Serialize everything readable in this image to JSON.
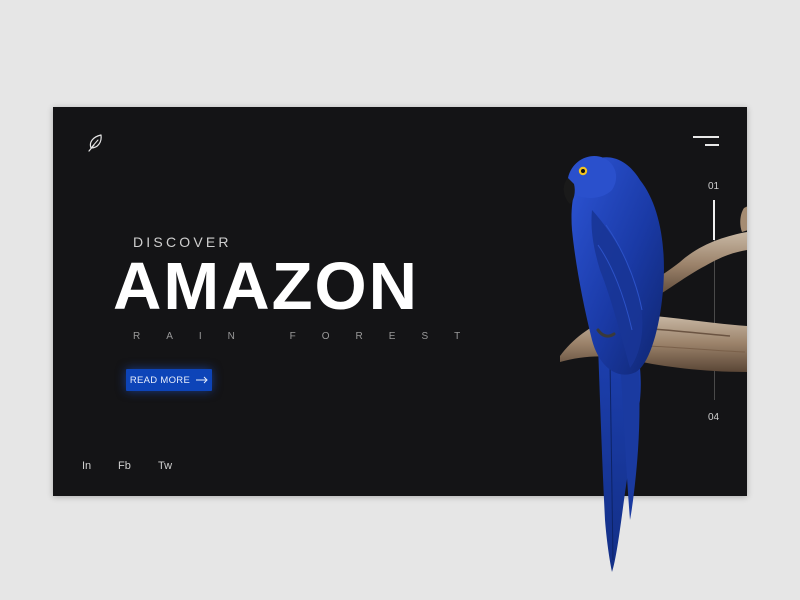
{
  "hero": {
    "eyebrow": "DISCOVER",
    "title": "AMAZON",
    "subtitle": "RAIN FOREST",
    "cta_label": "READ MORE"
  },
  "social": {
    "items": [
      "In",
      "Fb",
      "Tw"
    ]
  },
  "pager": {
    "current": "01",
    "total": "04",
    "progress": 0.2
  },
  "icons": {
    "logo": "feather-icon",
    "menu": "hamburger-menu-icon",
    "cta_arrow": "arrow-right-icon"
  },
  "colors": {
    "card_background": "#141416",
    "page_background": "#e6e6e6",
    "accent": "#0d44b8",
    "parrot_blue": "#1c3fae"
  }
}
